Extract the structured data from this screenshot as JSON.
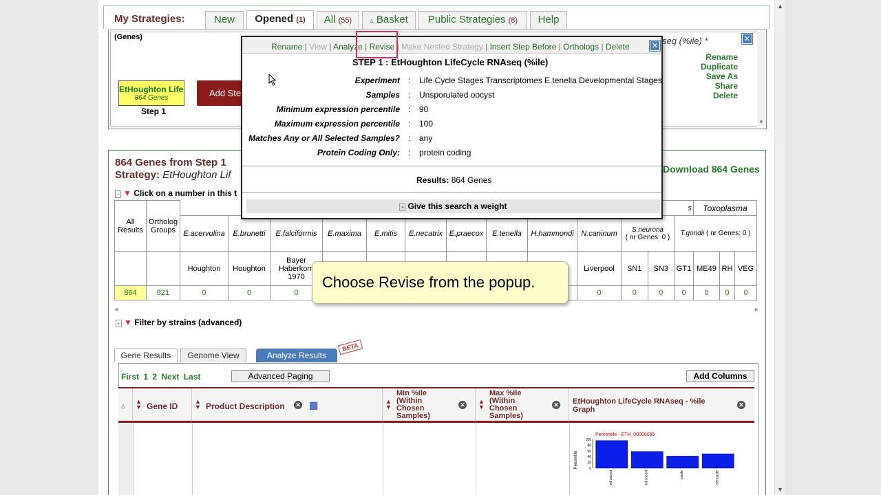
{
  "tabs": {
    "title": "My Strategies:",
    "new": "New",
    "opened": "Opened",
    "opened_count": "(1)",
    "all": "All",
    "all_count": "(55)",
    "basket": "Basket",
    "public": "Public Strategies",
    "public_count": "(8)",
    "help": "Help"
  },
  "strategy": {
    "panel_label": "(Genes)",
    "step_name": "EtHoughton LifeC",
    "step_count": "864 Genes",
    "step_label": "Step 1",
    "add_step": "Add Step",
    "name_right": "seq (%ile) *",
    "links": [
      "Rename",
      "Duplicate",
      "Save As",
      "Share",
      "Delete"
    ]
  },
  "popup": {
    "links": [
      {
        "label": "Rename",
        "state": "enabled"
      },
      {
        "label": "View",
        "state": "disabled"
      },
      {
        "label": "Analyze",
        "state": "enabled"
      },
      {
        "label": "Revise",
        "state": "enabled"
      },
      {
        "label": "Make Nested Strategy",
        "state": "disabled"
      },
      {
        "label": "Insert Step Before",
        "state": "enabled"
      },
      {
        "label": "Orthologs",
        "state": "enabled"
      },
      {
        "label": "Delete",
        "state": "enabled"
      }
    ],
    "title": "STEP 1 : EtHoughton LifeCycle RNAseq (%ile)",
    "params": [
      {
        "key": "Experiment",
        "value": "Life Cycle Stages Transcriptomes E.tenella Developmental Stages"
      },
      {
        "key": "Samples",
        "value": "Unsporulated oocyst"
      },
      {
        "key": "Minimum expression percentile",
        "value": "90"
      },
      {
        "key": "Maximum expression percentile",
        "value": "100"
      },
      {
        "key": "Matches Any or All Selected Samples?",
        "value": "any"
      },
      {
        "key": "Protein Coding Only:",
        "value": "protein coding"
      }
    ],
    "results_label": "Results:",
    "results_value": "864 Genes",
    "weight": "Give this search a weight"
  },
  "results": {
    "title": "864 Genes  from Step 1",
    "strategy_label": "Strategy:",
    "strategy_name": "EtHoughton Lif",
    "download": "Download 864 Genes",
    "click_hint": "Click on a number in this t",
    "filter_adv": "Filter by strains (advanced)"
  },
  "ortho_table": {
    "all_results": "All Results",
    "ortholog_groups": "Ortholog Groups",
    "group_s": "s",
    "group_toxoplasma": "Toxoplasma",
    "species": [
      "E.acervulina",
      "E.brunetti",
      "E.falciformis",
      "E.maxima",
      "E.mitis",
      "E.necatrix",
      "E.praecox",
      "E.tenella",
      "H.hammondi",
      "N.caninum"
    ],
    "sneurona": "S.neurona",
    "sneurona_nr": "( nr Genes: 0 )",
    "tgondii": "T.gondii",
    "tgondii_nr": "( nr Genes: 0 )",
    "strains": [
      "Houghton",
      "Houghton",
      "Bayer Haberkorn 1970",
      "",
      "",
      "",
      "",
      "",
      "",
      "Liverpool",
      "SN1",
      "SN3",
      "GT1",
      "ME49",
      "RH",
      "VEG"
    ],
    "counts": [
      "0",
      "0",
      "0",
      "",
      "",
      "",
      "",
      "",
      "",
      "0",
      "0",
      "0",
      "0",
      "0",
      "0",
      "0"
    ],
    "all_count": "864",
    "groups_count": "821"
  },
  "result_tabs": {
    "gene_results": "Gene Results",
    "genome_view": "Genome View",
    "analyze": "Analyze Results",
    "beta": "BETA"
  },
  "grid": {
    "paging": "First 1 2 Next Last",
    "advanced_paging": "Advanced Paging",
    "add_columns": "Add Columns",
    "col_gene_id": "Gene ID",
    "col_product": "Product Description",
    "col_min": "Min %ile (Within Chosen Samples)",
    "col_max": "Max %ile (Within Chosen Samples)",
    "col_graph": "EtHoughton LifeCycle RNAseq - %ile Graph"
  },
  "callout": "Choose Revise from the popup.",
  "chart_data": {
    "type": "bar",
    "title": "Percentile - ETH_00000065",
    "ylabel": "Percentile",
    "ylim": [
      0,
      100
    ],
    "yticks": [
      "100",
      "80",
      "60",
      "40",
      "20",
      "0"
    ],
    "categories": [
      "ed oocyst",
      "ed oocyst",
      "ozoite",
      "merozoite"
    ],
    "values": [
      96,
      58,
      42,
      50
    ],
    "color": "#0b1fe8"
  }
}
